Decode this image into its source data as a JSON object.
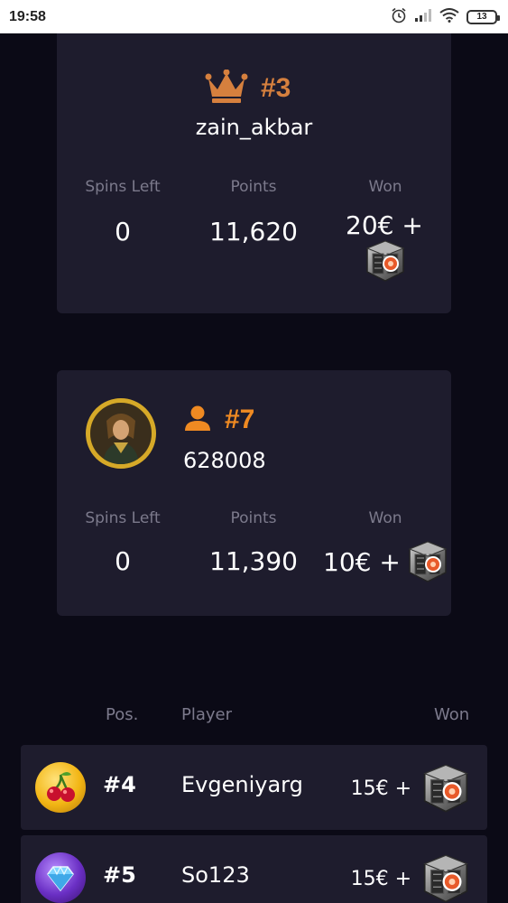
{
  "status_bar": {
    "time": "19:58",
    "battery": "13",
    "icons": [
      "alarm-icon",
      "signal-icon",
      "wifi-icon",
      "battery-icon"
    ]
  },
  "top_card": {
    "rank": "#3",
    "username": "zain_akbar",
    "labels": {
      "spins_left": "Spins Left",
      "points": "Points",
      "won": "Won"
    },
    "spins_left": "0",
    "points": "11,620",
    "won": "20€ +"
  },
  "my_card": {
    "rank": "#7",
    "username": "628008",
    "labels": {
      "spins_left": "Spins Left",
      "points": "Points",
      "won": "Won"
    },
    "spins_left": "0",
    "points": "11,390",
    "won": "10€ +"
  },
  "table": {
    "headers": {
      "pos": "Pos.",
      "player": "Player",
      "won": "Won"
    },
    "rows": [
      {
        "pos": "#4",
        "player": "Evgeniyarg",
        "won": "15€ +",
        "icon": "cherries-icon"
      },
      {
        "pos": "#5",
        "player": "So123",
        "won": "15€ +",
        "icon": "diamond-icon"
      }
    ]
  },
  "colors": {
    "background": "#0b0a16",
    "card": "#1e1c2d",
    "rank_bronze": "#d6803e",
    "rank_orange": "#ef8a22",
    "muted_text": "#7c7a8c"
  }
}
